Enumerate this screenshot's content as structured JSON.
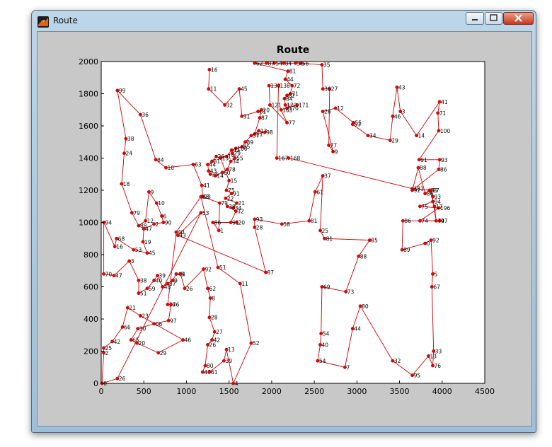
{
  "window": {
    "title": "Route",
    "icon": "matlab-figure-icon",
    "controls": [
      "minimize",
      "maximize",
      "close"
    ]
  },
  "chart_data": {
    "type": "line",
    "title": "Route",
    "xlabel": "",
    "ylabel": "",
    "xlim": [
      0,
      4500
    ],
    "ylim": [
      0,
      2000
    ],
    "xticks": [
      0,
      500,
      1000,
      1500,
      2000,
      2500,
      3000,
      3500,
      4000,
      4500
    ],
    "yticks": [
      0,
      200,
      400,
      600,
      800,
      1000,
      1200,
      1400,
      1600,
      1800,
      2000
    ],
    "grid": false,
    "line_color": "#cc0000",
    "marker_color": "#ee0000",
    "marker": "circle",
    "point_labels": true,
    "points": [
      {
        "label": "16",
        "x": 1270,
        "y": 1950
      },
      {
        "label": "11",
        "x": 1260,
        "y": 1830
      },
      {
        "label": "32",
        "x": 1450,
        "y": 1730
      },
      {
        "label": "45",
        "x": 1620,
        "y": 1830
      },
      {
        "label": "31",
        "x": 1650,
        "y": 1660
      },
      {
        "label": "61",
        "x": 1840,
        "y": 1690
      },
      {
        "label": "20",
        "x": 1880,
        "y": 1700
      },
      {
        "label": "87",
        "x": 1860,
        "y": 1650
      },
      {
        "label": "11",
        "x": 1800,
        "y": 1550
      },
      {
        "label": "13",
        "x": 1850,
        "y": 1570
      },
      {
        "label": "98",
        "x": 1920,
        "y": 1560
      },
      {
        "label": "57",
        "x": 1760,
        "y": 1540
      },
      {
        "label": "89",
        "x": 1690,
        "y": 1500
      },
      {
        "label": "85",
        "x": 1650,
        "y": 1470
      },
      {
        "label": "100",
        "x": 1580,
        "y": 1460
      },
      {
        "label": "42",
        "x": 1530,
        "y": 1450
      },
      {
        "label": "19",
        "x": 1470,
        "y": 1410
      },
      {
        "label": "13",
        "x": 1400,
        "y": 1400
      },
      {
        "label": "26",
        "x": 1350,
        "y": 1410
      },
      {
        "label": "81",
        "x": 1300,
        "y": 1380
      },
      {
        "label": "44",
        "x": 1250,
        "y": 1360
      },
      {
        "label": "43",
        "x": 1260,
        "y": 1320
      },
      {
        "label": "35",
        "x": 1280,
        "y": 1300
      },
      {
        "label": "14",
        "x": 1340,
        "y": 1290
      },
      {
        "label": "60",
        "x": 1420,
        "y": 1310
      },
      {
        "label": "78",
        "x": 1480,
        "y": 1330
      },
      {
        "label": "34",
        "x": 1520,
        "y": 1380
      },
      {
        "label": "55",
        "x": 1570,
        "y": 1400
      },
      {
        "label": "29",
        "x": 1540,
        "y": 1430
      },
      {
        "label": "15",
        "x": 1500,
        "y": 1260
      },
      {
        "label": "75",
        "x": 1470,
        "y": 1200
      },
      {
        "label": "91",
        "x": 1530,
        "y": 1180
      },
      {
        "label": "22",
        "x": 1460,
        "y": 1150
      },
      {
        "label": "21",
        "x": 1590,
        "y": 1120
      },
      {
        "label": "34",
        "x": 1550,
        "y": 1090
      },
      {
        "label": "38",
        "x": 1480,
        "y": 1100
      },
      {
        "label": "32",
        "x": 1580,
        "y": 1070
      },
      {
        "label": "91",
        "x": 1520,
        "y": 1000
      },
      {
        "label": "20",
        "x": 1590,
        "y": 1000
      },
      {
        "label": "86",
        "x": 1310,
        "y": 1000
      },
      {
        "label": "1",
        "x": 1380,
        "y": 950
      },
      {
        "label": "79",
        "x": 1390,
        "y": 1120
      },
      {
        "label": "93",
        "x": 1190,
        "y": 1160
      },
      {
        "label": "41",
        "x": 1180,
        "y": 1230
      },
      {
        "label": "63",
        "x": 1080,
        "y": 1360
      },
      {
        "label": "10",
        "x": 760,
        "y": 1340
      },
      {
        "label": "84",
        "x": 640,
        "y": 1390
      },
      {
        "label": "36",
        "x": 460,
        "y": 1670
      },
      {
        "label": "99",
        "x": 190,
        "y": 1820
      },
      {
        "label": "38",
        "x": 290,
        "y": 1520
      },
      {
        "label": "24",
        "x": 270,
        "y": 1430
      },
      {
        "label": "18",
        "x": 240,
        "y": 1240
      },
      {
        "label": "79",
        "x": 360,
        "y": 1060
      },
      {
        "label": "88",
        "x": 440,
        "y": 980
      },
      {
        "label": "12",
        "x": 520,
        "y": 1010
      },
      {
        "label": "9",
        "x": 560,
        "y": 1190
      },
      {
        "label": "10",
        "x": 650,
        "y": 1120
      },
      {
        "label": "6",
        "x": 710,
        "y": 1040
      },
      {
        "label": "90",
        "x": 730,
        "y": 1000
      },
      {
        "label": "2",
        "x": 620,
        "y": 990
      },
      {
        "label": "47",
        "x": 500,
        "y": 960
      },
      {
        "label": "19",
        "x": 490,
        "y": 880
      },
      {
        "label": "45",
        "x": 540,
        "y": 810
      },
      {
        "label": "53",
        "x": 380,
        "y": 830
      },
      {
        "label": "68",
        "x": 180,
        "y": 900
      },
      {
        "label": "16",
        "x": 160,
        "y": 850
      },
      {
        "label": "94",
        "x": 30,
        "y": 1000
      },
      {
        "label": "70",
        "x": 30,
        "y": 680
      },
      {
        "label": "47",
        "x": 150,
        "y": 670
      },
      {
        "label": "3",
        "x": 330,
        "y": 760
      },
      {
        "label": "38",
        "x": 440,
        "y": 640
      },
      {
        "label": "51",
        "x": 440,
        "y": 560
      },
      {
        "label": "59",
        "x": 540,
        "y": 590
      },
      {
        "label": "40",
        "x": 620,
        "y": 640
      },
      {
        "label": "39",
        "x": 660,
        "y": 670
      },
      {
        "label": "48",
        "x": 720,
        "y": 600
      },
      {
        "label": "37",
        "x": 780,
        "y": 620
      },
      {
        "label": "9",
        "x": 840,
        "y": 640
      },
      {
        "label": "45",
        "x": 880,
        "y": 680
      },
      {
        "label": "4",
        "x": 930,
        "y": 680
      },
      {
        "label": "26",
        "x": 980,
        "y": 590
      },
      {
        "label": "92",
        "x": 1200,
        "y": 710
      },
      {
        "label": "62",
        "x": 1250,
        "y": 590
      },
      {
        "label": "8",
        "x": 1280,
        "y": 530
      },
      {
        "label": "28",
        "x": 1270,
        "y": 410
      },
      {
        "label": "27",
        "x": 1330,
        "y": 320
      },
      {
        "label": "42",
        "x": 1300,
        "y": 270
      },
      {
        "label": "26",
        "x": 1250,
        "y": 240
      },
      {
        "label": "80",
        "x": 1220,
        "y": 110
      },
      {
        "label": "47",
        "x": 1190,
        "y": 70
      },
      {
        "label": "61",
        "x": 1270,
        "y": 70
      },
      {
        "label": "39",
        "x": 1440,
        "y": 140
      },
      {
        "label": "13",
        "x": 1470,
        "y": 210
      },
      {
        "label": "4",
        "x": 1550,
        "y": 0
      },
      {
        "label": "52",
        "x": 1760,
        "y": 250
      },
      {
        "label": "11",
        "x": 1630,
        "y": 620
      },
      {
        "label": "51",
        "x": 1370,
        "y": 720
      },
      {
        "label": "83",
        "x": 1170,
        "y": 1160
      },
      {
        "label": "40",
        "x": 880,
        "y": 940
      },
      {
        "label": "37",
        "x": 780,
        "y": 490
      },
      {
        "label": "46",
        "x": 820,
        "y": 490
      },
      {
        "label": "97",
        "x": 790,
        "y": 390
      },
      {
        "label": "06",
        "x": 620,
        "y": 370
      },
      {
        "label": "30",
        "x": 430,
        "y": 340
      },
      {
        "label": "65",
        "x": 350,
        "y": 270
      },
      {
        "label": "20",
        "x": 420,
        "y": 250
      },
      {
        "label": "29",
        "x": 670,
        "y": 190
      },
      {
        "label": "46",
        "x": 960,
        "y": 270
      },
      {
        "label": "23",
        "x": 460,
        "y": 420
      },
      {
        "label": "21",
        "x": 310,
        "y": 470
      },
      {
        "label": "66",
        "x": 250,
        "y": 350
      },
      {
        "label": "42",
        "x": 130,
        "y": 260
      },
      {
        "label": "25",
        "x": 30,
        "y": 220
      },
      {
        "label": "2",
        "x": 30,
        "y": 190
      },
      {
        "label": "0",
        "x": 10,
        "y": 0
      },
      {
        "label": "26",
        "x": 190,
        "y": 30
      },
      {
        "label": "53",
        "x": 1170,
        "y": 1060
      },
      {
        "label": "43",
        "x": 900,
        "y": 920
      },
      {
        "label": "87",
        "x": 1930,
        "y": 690
      },
      {
        "label": "28",
        "x": 1800,
        "y": 970
      },
      {
        "label": "93",
        "x": 1800,
        "y": 1020
      },
      {
        "label": "58",
        "x": 2120,
        "y": 990
      },
      {
        "label": "81",
        "x": 2440,
        "y": 1010
      },
      {
        "label": "61",
        "x": 2510,
        "y": 1190
      },
      {
        "label": "37",
        "x": 2600,
        "y": 1290
      },
      {
        "label": "25",
        "x": 2570,
        "y": 950
      },
      {
        "label": "81",
        "x": 2620,
        "y": 900
      },
      {
        "label": "85",
        "x": 3150,
        "y": 890
      },
      {
        "label": "88",
        "x": 3020,
        "y": 790
      },
      {
        "label": "73",
        "x": 2870,
        "y": 570
      },
      {
        "label": "69",
        "x": 2590,
        "y": 600
      },
      {
        "label": "54",
        "x": 2580,
        "y": 310
      },
      {
        "label": "40",
        "x": 2570,
        "y": 240
      },
      {
        "label": "54",
        "x": 2540,
        "y": 140
      },
      {
        "label": "7",
        "x": 2860,
        "y": 100
      },
      {
        "label": "44",
        "x": 2950,
        "y": 340
      },
      {
        "label": "80",
        "x": 3040,
        "y": 480
      },
      {
        "label": "32",
        "x": 3420,
        "y": 140
      },
      {
        "label": "95",
        "x": 3650,
        "y": 50
      },
      {
        "label": "13",
        "x": 3840,
        "y": 170
      },
      {
        "label": "76",
        "x": 3890,
        "y": 110
      },
      {
        "label": "33",
        "x": 3900,
        "y": 200
      },
      {
        "label": "67",
        "x": 3880,
        "y": 600
      },
      {
        "label": "5",
        "x": 3890,
        "y": 680
      },
      {
        "label": "92",
        "x": 3870,
        "y": 890
      },
      {
        "label": "0",
        "x": 3800,
        "y": 870
      },
      {
        "label": "89",
        "x": 3530,
        "y": 830
      },
      {
        "label": "86",
        "x": 3540,
        "y": 1010
      },
      {
        "label": "97",
        "x": 3970,
        "y": 1010
      },
      {
        "label": "74",
        "x": 3740,
        "y": 1010
      },
      {
        "label": "196",
        "x": 3960,
        "y": 1090
      },
      {
        "label": "75",
        "x": 3740,
        "y": 1100
      },
      {
        "label": "94",
        "x": 3890,
        "y": 1130
      },
      {
        "label": "93",
        "x": 3890,
        "y": 1160
      },
      {
        "label": "85",
        "x": 3850,
        "y": 1200
      },
      {
        "label": "86",
        "x": 3800,
        "y": 1180
      },
      {
        "label": "88",
        "x": 3720,
        "y": 1340
      },
      {
        "label": "92",
        "x": 3650,
        "y": 1200
      },
      {
        "label": "86",
        "x": 3960,
        "y": 1330
      },
      {
        "label": "93",
        "x": 3970,
        "y": 1390
      },
      {
        "label": "91",
        "x": 3730,
        "y": 1390
      },
      {
        "label": "100",
        "x": 3960,
        "y": 1570
      },
      {
        "label": "71",
        "x": 3950,
        "y": 1680
      },
      {
        "label": "41",
        "x": 3970,
        "y": 1750
      },
      {
        "label": "14",
        "x": 3700,
        "y": 1540
      },
      {
        "label": "3",
        "x": 3510,
        "y": 1690
      },
      {
        "label": "43",
        "x": 3470,
        "y": 1840
      },
      {
        "label": "46",
        "x": 3420,
        "y": 1660
      },
      {
        "label": "29",
        "x": 3390,
        "y": 1510
      },
      {
        "label": "34",
        "x": 3130,
        "y": 1540
      },
      {
        "label": "53",
        "x": 2950,
        "y": 1610
      },
      {
        "label": "55",
        "x": 2960,
        "y": 1620
      },
      {
        "label": "12",
        "x": 2750,
        "y": 1710
      },
      {
        "label": "26",
        "x": 2600,
        "y": 1690
      },
      {
        "label": "9",
        "x": 2720,
        "y": 1440
      },
      {
        "label": "77",
        "x": 2670,
        "y": 1480
      },
      {
        "label": "27",
        "x": 2680,
        "y": 1830
      },
      {
        "label": "36",
        "x": 2600,
        "y": 1830
      },
      {
        "label": "35",
        "x": 2590,
        "y": 1980
      },
      {
        "label": "56",
        "x": 2340,
        "y": 1990
      },
      {
        "label": "56",
        "x": 2280,
        "y": 1990
      },
      {
        "label": "84",
        "x": 2140,
        "y": 1990
      },
      {
        "label": "54",
        "x": 2030,
        "y": 1990
      },
      {
        "label": "87",
        "x": 1940,
        "y": 1990
      },
      {
        "label": "62",
        "x": 1800,
        "y": 1990
      },
      {
        "label": "81",
        "x": 2190,
        "y": 1940
      },
      {
        "label": "44",
        "x": 2160,
        "y": 1890
      },
      {
        "label": "72",
        "x": 2240,
        "y": 1850
      },
      {
        "label": "71",
        "x": 2220,
        "y": 1800
      },
      {
        "label": "82",
        "x": 2180,
        "y": 1790
      },
      {
        "label": "84",
        "x": 2150,
        "y": 1770
      },
      {
        "label": "173",
        "x": 2160,
        "y": 1730
      },
      {
        "label": "171",
        "x": 2300,
        "y": 1730
      },
      {
        "label": "170",
        "x": 2180,
        "y": 1710
      },
      {
        "label": "163",
        "x": 2110,
        "y": 1700
      },
      {
        "label": "77",
        "x": 2180,
        "y": 1620
      },
      {
        "label": "121",
        "x": 1980,
        "y": 1730
      },
      {
        "label": "139",
        "x": 1970,
        "y": 1850
      },
      {
        "label": "138",
        "x": 2080,
        "y": 1850
      },
      {
        "label": "167",
        "x": 2060,
        "y": 1400
      },
      {
        "label": "168",
        "x": 2200,
        "y": 1400
      },
      {
        "label": "181",
        "x": 3650,
        "y": 1210
      },
      {
        "label": "97",
        "x": 3870,
        "y": 1200
      },
      {
        "label": "74",
        "x": 3930,
        "y": 1010
      },
      {
        "label": "17",
        "x": 3910,
        "y": 1100
      }
    ],
    "route_order": [
      0,
      1,
      2,
      3,
      4,
      5,
      6,
      7,
      8,
      9,
      10,
      11,
      12,
      13,
      14,
      15,
      16,
      17,
      18,
      19,
      20,
      21,
      22,
      23,
      24,
      25,
      26,
      27,
      28,
      17,
      29,
      30,
      31,
      32,
      33,
      34,
      35,
      36,
      37,
      38,
      39,
      40,
      41,
      42,
      43,
      44,
      45,
      46,
      47,
      48,
      49,
      50,
      51,
      52,
      53,
      54,
      55,
      56,
      57,
      58,
      59,
      60,
      61,
      62,
      63,
      64,
      65,
      66,
      67,
      68,
      69,
      70,
      71,
      72,
      73,
      74,
      75,
      76,
      77,
      78,
      79,
      80,
      81,
      82,
      83,
      84,
      85,
      86,
      87,
      88,
      89,
      90,
      91,
      92,
      93,
      94,
      95,
      96,
      97,
      98,
      99,
      100,
      101,
      102,
      103,
      104,
      105,
      106,
      107,
      108,
      109,
      110,
      111,
      112,
      113,
      114,
      115,
      116,
      117,
      118,
      119,
      120,
      121,
      122,
      123,
      124,
      125,
      126,
      127,
      128,
      129,
      130,
      131,
      132,
      133,
      134,
      135,
      136,
      137,
      138,
      139,
      140,
      141,
      142,
      143,
      144,
      145,
      146,
      147,
      148,
      149,
      150,
      151,
      152,
      153,
      154,
      155,
      156,
      157,
      158,
      159,
      160,
      161,
      162,
      163,
      164,
      165,
      166,
      167,
      168,
      169,
      170,
      171,
      172,
      173,
      174,
      175,
      176,
      177,
      178,
      179,
      180,
      181,
      182,
      183,
      184,
      185,
      186,
      187,
      188,
      189,
      190,
      191,
      192,
      193,
      194,
      195,
      196,
      197,
      198,
      199,
      200,
      201,
      202,
      203,
      204,
      205,
      206,
      207,
      208,
      209,
      210,
      211,
      212,
      213,
      214,
      215,
      216,
      217,
      218,
      219,
      0
    ]
  }
}
